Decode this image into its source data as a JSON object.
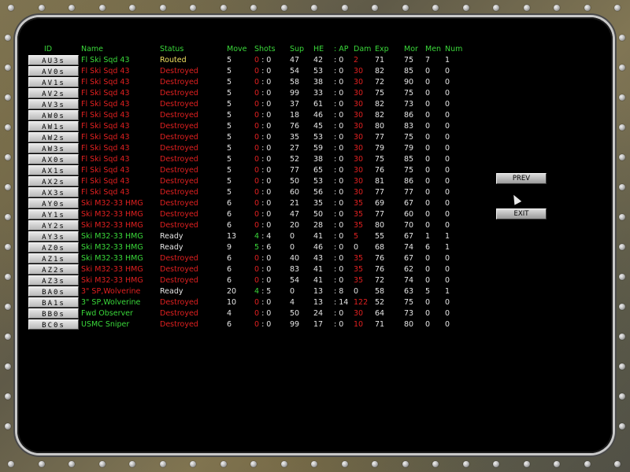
{
  "headers": {
    "id": "ID",
    "name": "Name",
    "status": "Status",
    "move": "Move",
    "shots": "Shots",
    "sup": "Sup",
    "he": "HE",
    "ap": ": AP",
    "dam": "Dam",
    "exp": "Exp",
    "mor": "Mor",
    "men": "Men",
    "num": "Num"
  },
  "colors": {
    "green": "#3ad83a",
    "red": "#e02020",
    "white": "#e6e6e6",
    "yellow": "#f0e060",
    "background": "#000000"
  },
  "buttons": {
    "prev": "PREV",
    "exit": "EXIT"
  },
  "units": [
    {
      "id": "AU3s",
      "name": "Fl Ski Sqd 43",
      "status": "Routed",
      "move": "5",
      "shots_a": "0",
      "shots_b": "0",
      "sup": "47",
      "he": "42",
      "ap": "0",
      "dam": "2",
      "exp": "71",
      "mor": "75",
      "men": "7",
      "num": "1",
      "name_color": "green",
      "status_color": "yellow"
    },
    {
      "id": "AV0s",
      "name": "Fl Ski Sqd 43",
      "status": "Destroyed",
      "move": "5",
      "shots_a": "0",
      "shots_b": "0",
      "sup": "54",
      "he": "53",
      "ap": "0",
      "dam": "30",
      "exp": "82",
      "mor": "85",
      "men": "0",
      "num": "0",
      "name_color": "red",
      "status_color": "red"
    },
    {
      "id": "AV1s",
      "name": "Fl Ski Sqd 43",
      "status": "Destroyed",
      "move": "5",
      "shots_a": "0",
      "shots_b": "0",
      "sup": "58",
      "he": "38",
      "ap": "0",
      "dam": "30",
      "exp": "72",
      "mor": "90",
      "men": "0",
      "num": "0",
      "name_color": "red",
      "status_color": "red"
    },
    {
      "id": "AV2s",
      "name": "Fl Ski Sqd 43",
      "status": "Destroyed",
      "move": "5",
      "shots_a": "0",
      "shots_b": "0",
      "sup": "99",
      "he": "33",
      "ap": "0",
      "dam": "30",
      "exp": "75",
      "mor": "75",
      "men": "0",
      "num": "0",
      "name_color": "red",
      "status_color": "red"
    },
    {
      "id": "AV3s",
      "name": "Fl Ski Sqd 43",
      "status": "Destroyed",
      "move": "5",
      "shots_a": "0",
      "shots_b": "0",
      "sup": "37",
      "he": "61",
      "ap": "0",
      "dam": "30",
      "exp": "82",
      "mor": "73",
      "men": "0",
      "num": "0",
      "name_color": "red",
      "status_color": "red"
    },
    {
      "id": "AW0s",
      "name": "Fl Ski Sqd 43",
      "status": "Destroyed",
      "move": "5",
      "shots_a": "0",
      "shots_b": "0",
      "sup": "18",
      "he": "46",
      "ap": "0",
      "dam": "30",
      "exp": "82",
      "mor": "86",
      "men": "0",
      "num": "0",
      "name_color": "red",
      "status_color": "red"
    },
    {
      "id": "AW1s",
      "name": "Fl Ski Sqd 43",
      "status": "Destroyed",
      "move": "5",
      "shots_a": "0",
      "shots_b": "0",
      "sup": "76",
      "he": "45",
      "ap": "0",
      "dam": "30",
      "exp": "80",
      "mor": "83",
      "men": "0",
      "num": "0",
      "name_color": "red",
      "status_color": "red"
    },
    {
      "id": "AW2s",
      "name": "Fl Ski Sqd 43",
      "status": "Destroyed",
      "move": "5",
      "shots_a": "0",
      "shots_b": "0",
      "sup": "35",
      "he": "53",
      "ap": "0",
      "dam": "30",
      "exp": "77",
      "mor": "75",
      "men": "0",
      "num": "0",
      "name_color": "red",
      "status_color": "red"
    },
    {
      "id": "AW3s",
      "name": "Fl Ski Sqd 43",
      "status": "Destroyed",
      "move": "5",
      "shots_a": "0",
      "shots_b": "0",
      "sup": "27",
      "he": "59",
      "ap": "0",
      "dam": "30",
      "exp": "79",
      "mor": "79",
      "men": "0",
      "num": "0",
      "name_color": "red",
      "status_color": "red"
    },
    {
      "id": "AX0s",
      "name": "Fl Ski Sqd 43",
      "status": "Destroyed",
      "move": "5",
      "shots_a": "0",
      "shots_b": "0",
      "sup": "52",
      "he": "38",
      "ap": "0",
      "dam": "30",
      "exp": "75",
      "mor": "85",
      "men": "0",
      "num": "0",
      "name_color": "red",
      "status_color": "red"
    },
    {
      "id": "AX1s",
      "name": "Fl Ski Sqd 43",
      "status": "Destroyed",
      "move": "5",
      "shots_a": "0",
      "shots_b": "0",
      "sup": "77",
      "he": "65",
      "ap": "0",
      "dam": "30",
      "exp": "76",
      "mor": "75",
      "men": "0",
      "num": "0",
      "name_color": "red",
      "status_color": "red"
    },
    {
      "id": "AX2s",
      "name": "Fl Ski Sqd 43",
      "status": "Destroyed",
      "move": "5",
      "shots_a": "0",
      "shots_b": "0",
      "sup": "50",
      "he": "53",
      "ap": "0",
      "dam": "30",
      "exp": "81",
      "mor": "86",
      "men": "0",
      "num": "0",
      "name_color": "red",
      "status_color": "red"
    },
    {
      "id": "AX3s",
      "name": "Fl Ski Sqd 43",
      "status": "Destroyed",
      "move": "5",
      "shots_a": "0",
      "shots_b": "0",
      "sup": "60",
      "he": "56",
      "ap": "0",
      "dam": "30",
      "exp": "77",
      "mor": "77",
      "men": "0",
      "num": "0",
      "name_color": "red",
      "status_color": "red"
    },
    {
      "id": "AY0s",
      "name": "Ski M32-33 HMG",
      "status": "Destroyed",
      "move": "6",
      "shots_a": "0",
      "shots_b": "0",
      "sup": "21",
      "he": "35",
      "ap": "0",
      "dam": "35",
      "exp": "69",
      "mor": "67",
      "men": "0",
      "num": "0",
      "name_color": "red",
      "status_color": "red"
    },
    {
      "id": "AY1s",
      "name": "Ski M32-33 HMG",
      "status": "Destroyed",
      "move": "6",
      "shots_a": "0",
      "shots_b": "0",
      "sup": "47",
      "he": "50",
      "ap": "0",
      "dam": "35",
      "exp": "77",
      "mor": "60",
      "men": "0",
      "num": "0",
      "name_color": "red",
      "status_color": "red"
    },
    {
      "id": "AY2s",
      "name": "Ski M32-33 HMG",
      "status": "Destroyed",
      "move": "6",
      "shots_a": "0",
      "shots_b": "0",
      "sup": "20",
      "he": "28",
      "ap": "0",
      "dam": "35",
      "exp": "80",
      "mor": "70",
      "men": "0",
      "num": "0",
      "name_color": "red",
      "status_color": "red"
    },
    {
      "id": "AY3s",
      "name": "Ski M32-33 HMG",
      "status": "Ready",
      "move": "13",
      "shots_a": "4",
      "shots_b": "4",
      "sup": "0",
      "he": "41",
      "ap": "0",
      "dam": "5",
      "exp": "55",
      "mor": "67",
      "men": "1",
      "num": "1",
      "name_color": "green",
      "status_color": "white"
    },
    {
      "id": "AZ0s",
      "name": "Ski M32-33 HMG",
      "status": "Ready",
      "move": "9",
      "shots_a": "5",
      "shots_b": "6",
      "sup": "0",
      "he": "46",
      "ap": "0",
      "dam": "0",
      "exp": "68",
      "mor": "74",
      "men": "6",
      "num": "1",
      "name_color": "green",
      "status_color": "white"
    },
    {
      "id": "AZ1s",
      "name": "Ski M32-33 HMG",
      "status": "Destroyed",
      "move": "6",
      "shots_a": "0",
      "shots_b": "0",
      "sup": "40",
      "he": "43",
      "ap": "0",
      "dam": "35",
      "exp": "76",
      "mor": "67",
      "men": "0",
      "num": "0",
      "name_color": "green",
      "status_color": "red"
    },
    {
      "id": "AZ2s",
      "name": "Ski M32-33 HMG",
      "status": "Destroyed",
      "move": "6",
      "shots_a": "0",
      "shots_b": "0",
      "sup": "83",
      "he": "41",
      "ap": "0",
      "dam": "35",
      "exp": "76",
      "mor": "62",
      "men": "0",
      "num": "0",
      "name_color": "red",
      "status_color": "red"
    },
    {
      "id": "AZ3s",
      "name": "Ski M32-33 HMG",
      "status": "Destroyed",
      "move": "6",
      "shots_a": "0",
      "shots_b": "0",
      "sup": "54",
      "he": "41",
      "ap": "0",
      "dam": "35",
      "exp": "72",
      "mor": "74",
      "men": "0",
      "num": "0",
      "name_color": "red",
      "status_color": "red"
    },
    {
      "id": "BA0s",
      "name": "3\" SP,Wolverine",
      "status": "Ready",
      "move": "20",
      "shots_a": "4",
      "shots_b": "5",
      "sup": "0",
      "he": "13",
      "ap": "8",
      "dam": "0",
      "exp": "58",
      "mor": "63",
      "men": "5",
      "num": "1",
      "name_color": "red",
      "status_color": "white"
    },
    {
      "id": "BA1s",
      "name": "3\" SP,Wolverine",
      "status": "Destroyed",
      "move": "10",
      "shots_a": "0",
      "shots_b": "0",
      "sup": "4",
      "he": "13",
      "ap": "14",
      "dam": "122",
      "exp": "52",
      "mor": "75",
      "men": "0",
      "num": "0",
      "name_color": "green",
      "status_color": "red"
    },
    {
      "id": "BB0s",
      "name": "Fwd Observer",
      "status": "Destroyed",
      "move": "4",
      "shots_a": "0",
      "shots_b": "0",
      "sup": "50",
      "he": "24",
      "ap": "0",
      "dam": "30",
      "exp": "64",
      "mor": "73",
      "men": "0",
      "num": "0",
      "name_color": "green",
      "status_color": "red"
    },
    {
      "id": "BC0s",
      "name": "USMC Sniper",
      "status": "Destroyed",
      "move": "6",
      "shots_a": "0",
      "shots_b": "0",
      "sup": "99",
      "he": "17",
      "ap": "0",
      "dam": "10",
      "exp": "71",
      "mor": "80",
      "men": "0",
      "num": "0",
      "name_color": "green",
      "status_color": "red"
    }
  ]
}
